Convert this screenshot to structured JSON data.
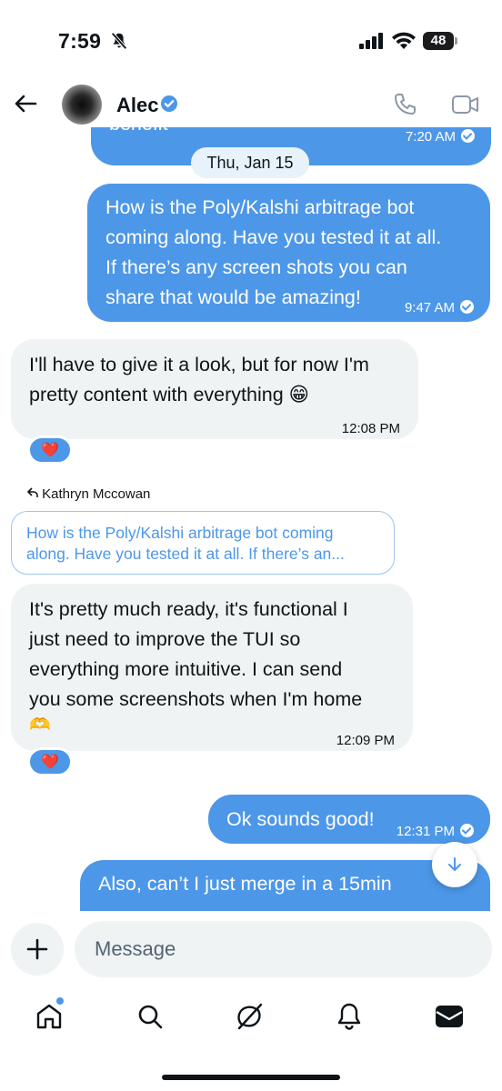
{
  "status_bar": {
    "time": "7:59",
    "battery": "48"
  },
  "header": {
    "name": "Alec"
  },
  "messages": [
    {
      "text": "benefit",
      "time": "7:20 AM"
    },
    {
      "date": "Thu, Jan 15"
    },
    {
      "lines": [
        "How is the Poly/Kalshi arbitrage bot",
        "coming along. Have you tested it at all.",
        "If there’s any screen shots you can",
        "share that would be amazing!"
      ],
      "time": "9:47 AM"
    },
    {
      "lines": [
        "I'll have to give it a look, but for now I'm",
        "pretty content with everything 😁"
      ],
      "time": "12:08 PM",
      "reaction": "❤️"
    },
    {
      "reply_to": "Kathryn Mccowan",
      "quote_lines": [
        "How is the Poly/Kalshi arbitrage bot coming",
        "along. Have you tested it at all. If there’s an..."
      ]
    },
    {
      "lines": [
        "It's pretty much ready, it's functional I",
        "just need to improve the TUI so",
        "everything more intuitive. I can send",
        "you some screenshots when I'm home",
        "🫶"
      ],
      "time": "12:09 PM",
      "reaction": "❤️"
    },
    {
      "text": "Ok sounds good!",
      "time": "12:31 PM"
    },
    {
      "lines": [
        "Also, can’t I just merge in a 15min"
      ]
    }
  ],
  "composer": {
    "placeholder": "Message"
  },
  "icons": {
    "back": "arrow-left-icon",
    "verified": "verified-badge-icon",
    "phone": "phone-icon",
    "video": "video-icon",
    "plus": "plus-icon",
    "home": "home-icon",
    "search": "search-icon",
    "grok": "grok-icon",
    "notifications": "bell-icon",
    "messages": "envelope-icon",
    "scroll": "arrow-down-icon"
  },
  "colors": {
    "accent": "#4d97e8",
    "incoming": "#eff3f4",
    "text": "#0f1419"
  }
}
